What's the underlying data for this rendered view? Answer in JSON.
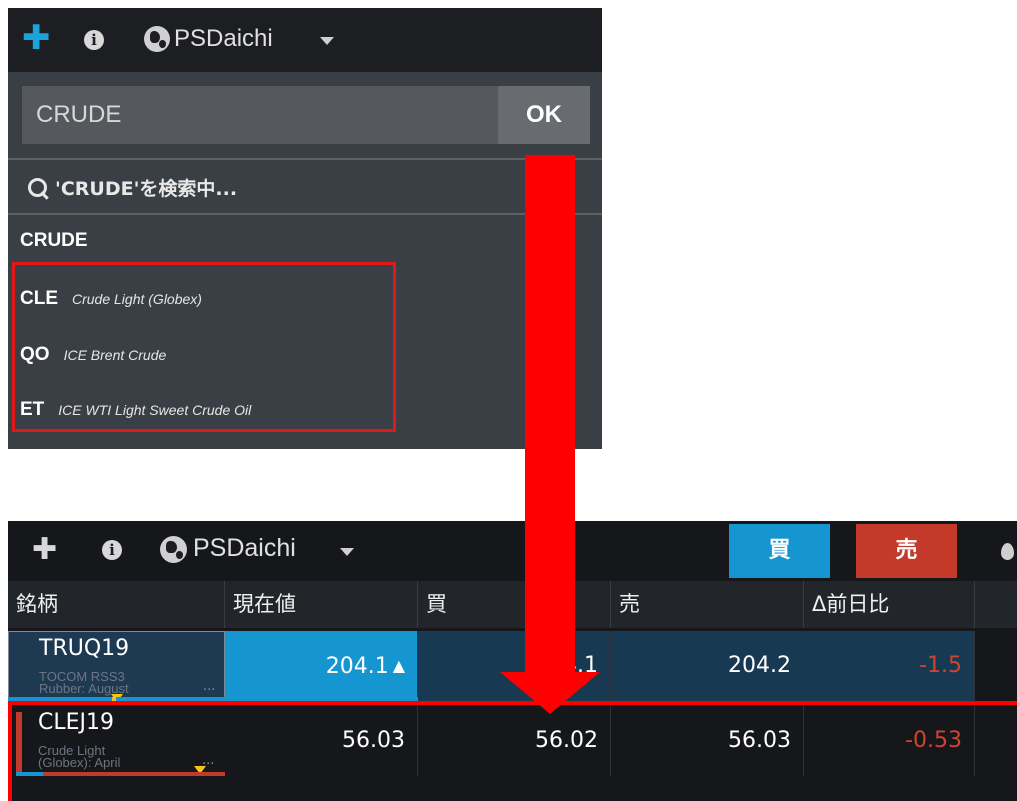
{
  "top_panel": {
    "toolbar": {
      "add_icon": "plus-icon",
      "info_icon": "info-icon",
      "globe_icon": "globe-icon",
      "workspace_name": "PSDaichi"
    },
    "search": {
      "value": "CRUDE",
      "ok_label": "OK",
      "searching_text": "'CRUDE'を検索中..."
    },
    "results": {
      "group_label": "CRUDE",
      "items": [
        {
          "symbol": "CLE",
          "description": "Crude Light (Globex)"
        },
        {
          "symbol": "QO",
          "description": "ICE Brent Crude"
        },
        {
          "symbol": "ET",
          "description": "ICE WTI Light Sweet Crude Oil"
        }
      ]
    }
  },
  "bottom_panel": {
    "toolbar": {
      "workspace_name": "PSDaichi",
      "buy_label": "買",
      "sell_label": "売"
    },
    "table": {
      "columns": [
        "銘柄",
        "現在値",
        "買",
        "売",
        "Δ前日比"
      ],
      "rows": [
        {
          "symbol": "TRUQ19",
          "sub1": "TOCOM RSS3",
          "sub2": "Rubber: August",
          "last": "204.1",
          "last_arrow": "▲",
          "bid": "204.1",
          "ask": "204.2",
          "change": "-1.5"
        },
        {
          "symbol": "CLEJ19",
          "sub1": "Crude Light",
          "sub2": "(Globex): April",
          "last": "56.03",
          "bid": "56.02",
          "ask": "56.03",
          "change": "-0.53"
        }
      ]
    }
  },
  "ellipsis": "...",
  "colors": {
    "accent_blue": "#1596d0",
    "sell_red": "#c43a2a",
    "negative_red": "#d0452f",
    "annotation_red": "#ff0000"
  }
}
